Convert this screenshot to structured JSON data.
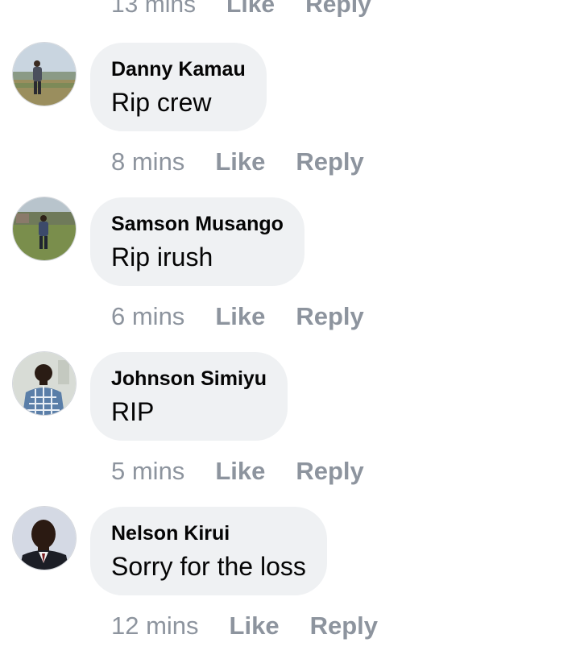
{
  "top_partial": {
    "time": "13 mins",
    "like": "Like",
    "reply": "Reply"
  },
  "comments": [
    {
      "author": "Danny Kamau",
      "text": "Rip crew",
      "time": "8 mins",
      "like": "Like",
      "reply": "Reply"
    },
    {
      "author": "Samson Musango",
      "text": "Rip irush",
      "time": "6 mins",
      "like": "Like",
      "reply": "Reply"
    },
    {
      "author": "Johnson Simiyu",
      "text": "RIP",
      "time": "5 mins",
      "like": "Like",
      "reply": "Reply"
    },
    {
      "author": "Nelson Kirui",
      "text": "Sorry for the loss",
      "time": "12 mins",
      "like": "Like",
      "reply": "Reply"
    }
  ],
  "colors": {
    "bubble": "#eff1f3",
    "meta": "#8d949e",
    "text": "#050505"
  }
}
